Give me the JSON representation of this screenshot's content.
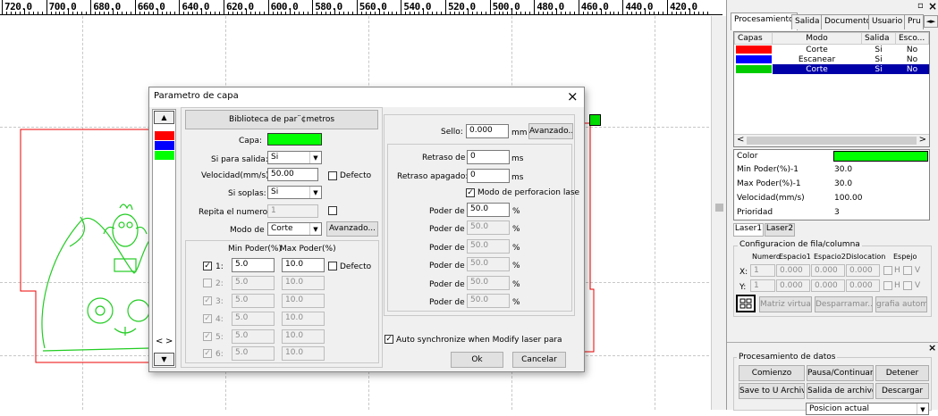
{
  "ruler": {
    "labels": [
      "720.0",
      "700.0",
      "680.0",
      "660.0",
      "640.0",
      "620.0",
      "600.0",
      "580.0",
      "560.0",
      "540.0",
      "520.0",
      "500.0",
      "480.0",
      "460.0",
      "440.0",
      "420.0"
    ]
  },
  "window_controls": {
    "restore": "▫",
    "close": "×"
  },
  "right_tabs": [
    "Procesamiento",
    "Salida",
    "Documento",
    "Usuario",
    "Pru"
  ],
  "tab_arrows": {
    "left": "◄",
    "right": "►"
  },
  "layers": {
    "headers": [
      "Capas",
      "Modo",
      "Salida",
      "Esco..."
    ],
    "rows": [
      {
        "color": "#ff0000",
        "mode": "Corte",
        "output": "Si",
        "hide": "No"
      },
      {
        "color": "#0000ff",
        "mode": "Escanear",
        "output": "Si",
        "hide": "No"
      },
      {
        "color": "#00cc00",
        "mode": "Corte",
        "output": "Si",
        "hide": "No"
      }
    ]
  },
  "props": [
    {
      "label": "Color",
      "value": ""
    },
    {
      "label": "Min Poder(%)-1",
      "value": "30.0"
    },
    {
      "label": "Max Poder(%)-1",
      "value": "30.0"
    },
    {
      "label": "Velocidad(mm/s)",
      "value": "100.00"
    },
    {
      "label": "Prioridad",
      "value": "3"
    }
  ],
  "laser_tabs": [
    "Laser1",
    "Laser2"
  ],
  "array": {
    "title": "Configuracion de fila/columna",
    "headers": [
      "Numero",
      "Espacio1",
      "Espacio2",
      "Dislocation",
      "Espejo"
    ],
    "x_label": "X:",
    "y_label": "Y:",
    "x": {
      "num": "1",
      "e1": "0.000",
      "e2": "0.000",
      "dis": "0.000"
    },
    "y": {
      "num": "1",
      "e1": "0.000",
      "e2": "0.000",
      "dis": "0.000"
    },
    "h": "H",
    "v": "V",
    "buttons": [
      "Matriz virtual",
      "Desparramar...",
      "grafia autom"
    ]
  },
  "data_panel": {
    "title": "Procesamiento de datos",
    "buttons": [
      "Comienzo",
      "Pausa/Continuar",
      "Detener",
      "Save to U Archivo",
      "Salida de archivo U",
      "Descargar"
    ],
    "dropdown": "Posicion actual"
  },
  "dialog": {
    "title": "Parametro de capa",
    "close": "×",
    "library_button": "Biblioteca de par¨¢metros",
    "capa_label": "Capa:",
    "capa_color": "#00ff00",
    "output_label": "Si para salida:",
    "output_value": "Si",
    "speed_label": "Velocidad(mm/s):",
    "speed_value": "50.00",
    "default_label": "Defecto",
    "blow_label": "Si soplas:",
    "blow_value": "Si",
    "repeat_label": "Repita el numero:",
    "repeat_value": "1",
    "mode_label": "Modo de",
    "mode_value": "Corte",
    "advanced": "Avanzado...",
    "power_headers": [
      "Min Poder(%)",
      "Max Poder(%)"
    ],
    "power_default": "Defecto",
    "power_rows": [
      {
        "label": "1:",
        "min": "5.0",
        "max": "10.0",
        "checked": true,
        "enabled": true
      },
      {
        "label": "2:",
        "min": "5.0",
        "max": "10.0",
        "checked": false,
        "enabled": false
      },
      {
        "label": "3:",
        "min": "5.0",
        "max": "10.0",
        "checked": true,
        "enabled": false
      },
      {
        "label": "4:",
        "min": "5.0",
        "max": "10.0",
        "checked": true,
        "enabled": false
      },
      {
        "label": "5:",
        "min": "5.0",
        "max": "10.0",
        "checked": true,
        "enabled": false
      },
      {
        "label": "6:",
        "min": "5.0",
        "max": "10.0",
        "checked": true,
        "enabled": false
      }
    ],
    "seal_label": "Sello:",
    "seal_value": "0.000",
    "seal_unit": "mm",
    "seal_advanced": "Avanzado...",
    "delay_on_label": "Retraso de",
    "delay_on_value": "0",
    "delay_unit": "ms",
    "delay_off_label": "Retraso apagado:",
    "delay_off_value": "0",
    "perf_label": "Modo de perforacion lase",
    "poder_label": "Poder de",
    "poder_values": [
      "50.0",
      "50.0",
      "50.0",
      "50.0",
      "50.0",
      "50.0"
    ],
    "pct": "%",
    "auto_sync": "Auto synchronize when Modify laser para",
    "ok": "Ok",
    "cancel": "Cancelar",
    "check_mark": "✓",
    "up_arrow": "▲",
    "down_arrow": "▼",
    "nav_left": "<",
    "nav_right": ">"
  }
}
